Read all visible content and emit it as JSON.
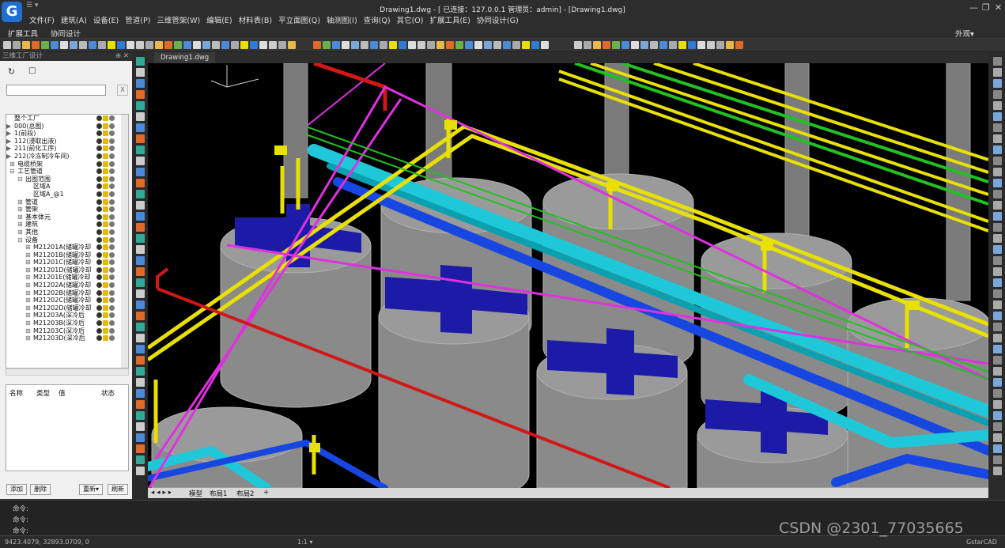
{
  "app": {
    "title": "Drawing1.dwg - [ 已连接：127.0.0.1 管理员：admin] - [Drawing1.dwg]",
    "logo_letter": "G",
    "quick_access": "☰ ▾",
    "window_controls": [
      "—",
      "❐",
      "✕"
    ]
  },
  "menu": [
    "文件(F)",
    "建筑(A)",
    "设备(E)",
    "管道(P)",
    "三维管架(W)",
    "编辑(E)",
    "材料表(B)",
    "平立面图(Q)",
    "轴测图(I)",
    "查询(Q)",
    "其它(O)",
    "扩展工具(E)",
    "协同设计(G)"
  ],
  "ribbon_tabs": [
    "扩展工具",
    "协同设计"
  ],
  "ribbon_right": "外观▾",
  "panel": {
    "title": "三维工厂设计",
    "pin": "⊕ ✕",
    "refresh_icon": "↻",
    "tool_icon": "□",
    "search_value": "",
    "search_clear": "X",
    "tree": [
      {
        "label": "整个工厂",
        "indent": 0,
        "toggle": ""
      },
      {
        "label": "000(总图)",
        "indent": 0,
        "toggle": "▶"
      },
      {
        "label": "1(前段)",
        "indent": 0,
        "toggle": "▶"
      },
      {
        "label": "112(浸取出液)",
        "indent": 0,
        "toggle": "▶"
      },
      {
        "label": "211(前化工序)",
        "indent": 0,
        "toggle": "▶"
      },
      {
        "label": "212(冷冻制冷车间)",
        "indent": 0,
        "toggle": "▶"
      },
      {
        "label": "电缆桥架",
        "indent": 1,
        "toggle": "⊞"
      },
      {
        "label": "工艺管道",
        "indent": 1,
        "toggle": "⊟"
      },
      {
        "label": "出图范围",
        "indent": 2,
        "toggle": "⊟"
      },
      {
        "label": "区域A",
        "indent": 3,
        "toggle": ""
      },
      {
        "label": "区域A_@1",
        "indent": 3,
        "toggle": ""
      },
      {
        "label": "管道",
        "indent": 2,
        "toggle": "⊞"
      },
      {
        "label": "管架",
        "indent": 2,
        "toggle": "⊞"
      },
      {
        "label": "基本体元",
        "indent": 2,
        "toggle": "⊞"
      },
      {
        "label": "建筑",
        "indent": 2,
        "toggle": "⊞"
      },
      {
        "label": "其他",
        "indent": 2,
        "toggle": "⊞"
      },
      {
        "label": "设备",
        "indent": 2,
        "toggle": "⊟"
      },
      {
        "label": "M21201A(储罐冷却",
        "indent": 3,
        "toggle": "⊞"
      },
      {
        "label": "M21201B(储罐冷却",
        "indent": 3,
        "toggle": "⊞"
      },
      {
        "label": "M21201C(储罐冷却",
        "indent": 3,
        "toggle": "⊞"
      },
      {
        "label": "M21201D(储罐冷却",
        "indent": 3,
        "toggle": "⊞"
      },
      {
        "label": "M21201E(储罐冷却",
        "indent": 3,
        "toggle": "⊞"
      },
      {
        "label": "M21202A(储罐冷却",
        "indent": 3,
        "toggle": "⊞"
      },
      {
        "label": "M21202B(储罐冷却",
        "indent": 3,
        "toggle": "⊞"
      },
      {
        "label": "M21202C(储罐冷却",
        "indent": 3,
        "toggle": "⊞"
      },
      {
        "label": "M21202D(储罐冷却",
        "indent": 3,
        "toggle": "⊞"
      },
      {
        "label": "M21203A(深冷后",
        "indent": 3,
        "toggle": "⊞"
      },
      {
        "label": "M21203B(深冷后",
        "indent": 3,
        "toggle": "⊞"
      },
      {
        "label": "M21203C(深冷后",
        "indent": 3,
        "toggle": "⊞"
      },
      {
        "label": "M21203D(深冷后",
        "indent": 3,
        "toggle": "⊞"
      }
    ],
    "props_headers": [
      "名称",
      "类型",
      "值",
      "状态"
    ],
    "buttons": [
      "添加",
      "删除",
      "重新▾",
      "刷新"
    ]
  },
  "document_tab": "Drawing1.dwg",
  "layout_tabs": [
    "模型",
    "布局1",
    "布局2",
    "+"
  ],
  "command_lines": [
    "命令:",
    "命令:",
    "命令:"
  ],
  "status": {
    "coords": "9423.4079, 32893.0709, 0",
    "scale": "1:1 ▾",
    "brand": "GstarCAD"
  },
  "watermark": "CSDN @2301_77035665",
  "colors": {
    "cyan": "#1ec8d8",
    "yellow": "#e8e000",
    "blue": "#1846e0",
    "navy": "#1b1ba8",
    "magenta": "#e030e0",
    "green": "#22c022",
    "red": "#d01818",
    "tank": "#8a8a8a"
  }
}
